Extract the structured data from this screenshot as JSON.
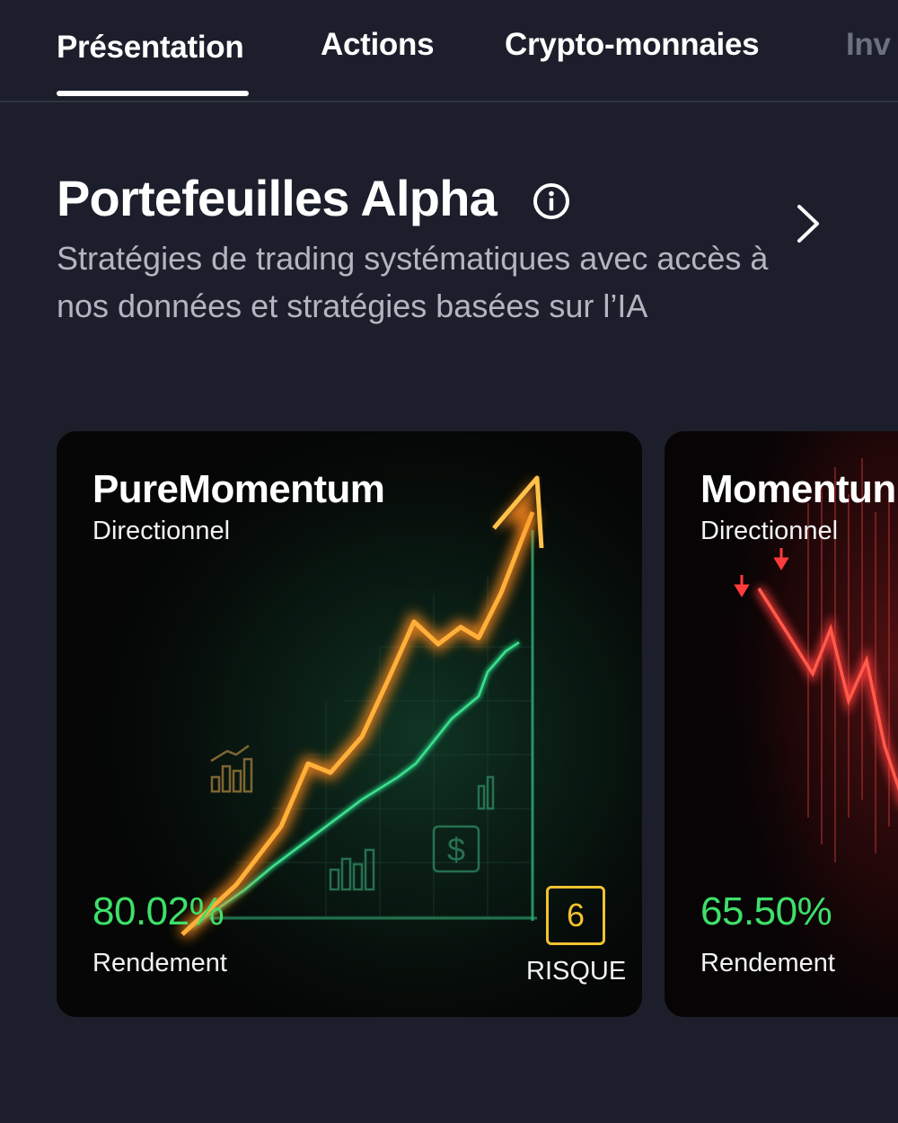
{
  "tabs": [
    {
      "label": "Présentation",
      "active": true
    },
    {
      "label": "Actions",
      "active": false
    },
    {
      "label": "Crypto-monnaies",
      "active": false
    },
    {
      "label": "Inv",
      "active": false
    }
  ],
  "section": {
    "title": "Portefeuilles Alpha",
    "info_icon": "info-circle-icon",
    "chevron_icon": "chevron-right-icon",
    "description": "Stratégies de trading systématiques avec accès à nos données et stratégies basées sur l’IA"
  },
  "cards": [
    {
      "name": "PureMomentum",
      "type": "Directionnel",
      "return_value": "80.02%",
      "return_label": "Rendement",
      "risk_value": "6",
      "risk_label": "RISQUE",
      "return_color": "#3ee06a",
      "risk_color": "#f2c230"
    },
    {
      "name": "Momentun",
      "type": "Directionnel",
      "return_value": "65.50%",
      "return_label": "Rendement",
      "return_color": "#3ee06a"
    }
  ],
  "colors": {
    "background": "#1c1f2b",
    "accent_green": "#3ee06a",
    "accent_yellow": "#f2c230",
    "muted_text": "#b3b6c0"
  }
}
